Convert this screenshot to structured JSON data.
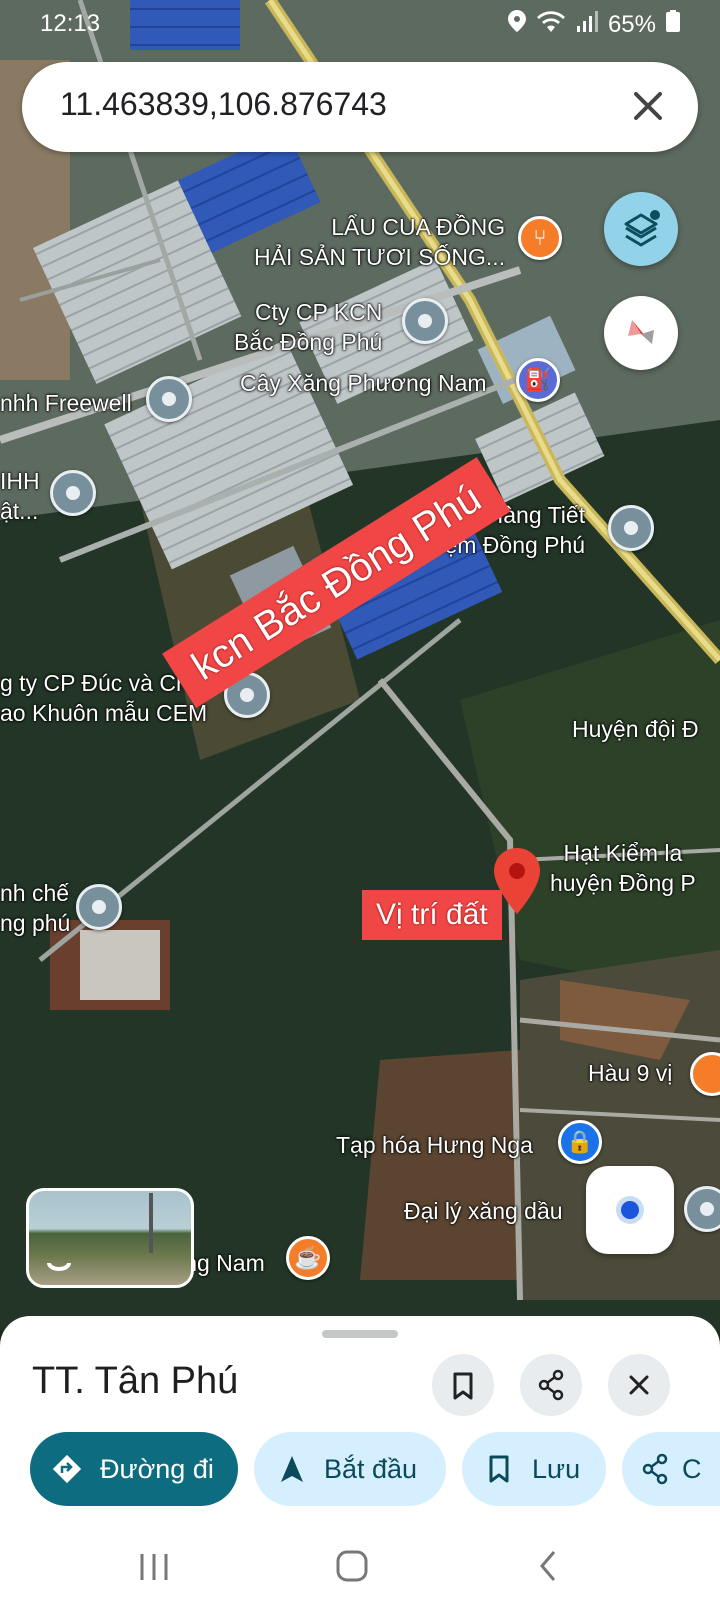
{
  "status_bar": {
    "time": "12:13",
    "battery": "65%"
  },
  "search": {
    "query": "11.463839,106.876743"
  },
  "map": {
    "places": [
      {
        "id": "lau-cua-dong",
        "name": "LẨU CUA ĐỒNG\nHẢI SẢN TƯƠI SỐNG..."
      },
      {
        "id": "cty-cp-kcn",
        "name": "Cty CP KCN\nBắc Đồng Phú"
      },
      {
        "id": "cay-xang",
        "name": "Cây Xăng Phương Nam"
      },
      {
        "id": "freewell",
        "name": "nhh Freewell"
      },
      {
        "id": "tnhh-nhat",
        "name": "IHH\nật..."
      },
      {
        "id": "giao-hang",
        "name": "Giao Hàng Tiết\nKiệm Đồng Phú"
      },
      {
        "id": "cty-duc",
        "name": "g ty CP Đúc và Chế\nao Khuôn mẫu CEM"
      },
      {
        "id": "huyen-doi",
        "name": "Huyện đội Đ"
      },
      {
        "id": "hat-kiem-lam",
        "name": "Hạt Kiểm la\nhuyện Đồng P"
      },
      {
        "id": "nh-che",
        "name": "nh chế\nng phú"
      },
      {
        "id": "hau-9-vi",
        "name": "Hàu 9 vị"
      },
      {
        "id": "tap-hoa",
        "name": "Tạp hóa Hưng Nga"
      },
      {
        "id": "dai-ly-xang",
        "name": "Đại lý xăng dầu"
      },
      {
        "id": "hoang-nam",
        "name": "Hoàng Nam"
      }
    ],
    "banner": "kcn Bắc Đồng Phú",
    "marker_label": "Vị trí đất"
  },
  "sheet": {
    "title": "TT. Tân Phú",
    "actions": [
      {
        "label": "Đường đi",
        "icon": "directions-icon"
      },
      {
        "label": "Bắt đầu",
        "icon": "navigation-arrow-icon"
      },
      {
        "label": "Lưu",
        "icon": "bookmark-icon"
      },
      {
        "label": "C",
        "icon": "share-icon"
      }
    ]
  },
  "colors": {
    "accent": "#0e6c80",
    "chip": "#d6efff",
    "banner": "#f04646",
    "marker": "#ea4335"
  }
}
